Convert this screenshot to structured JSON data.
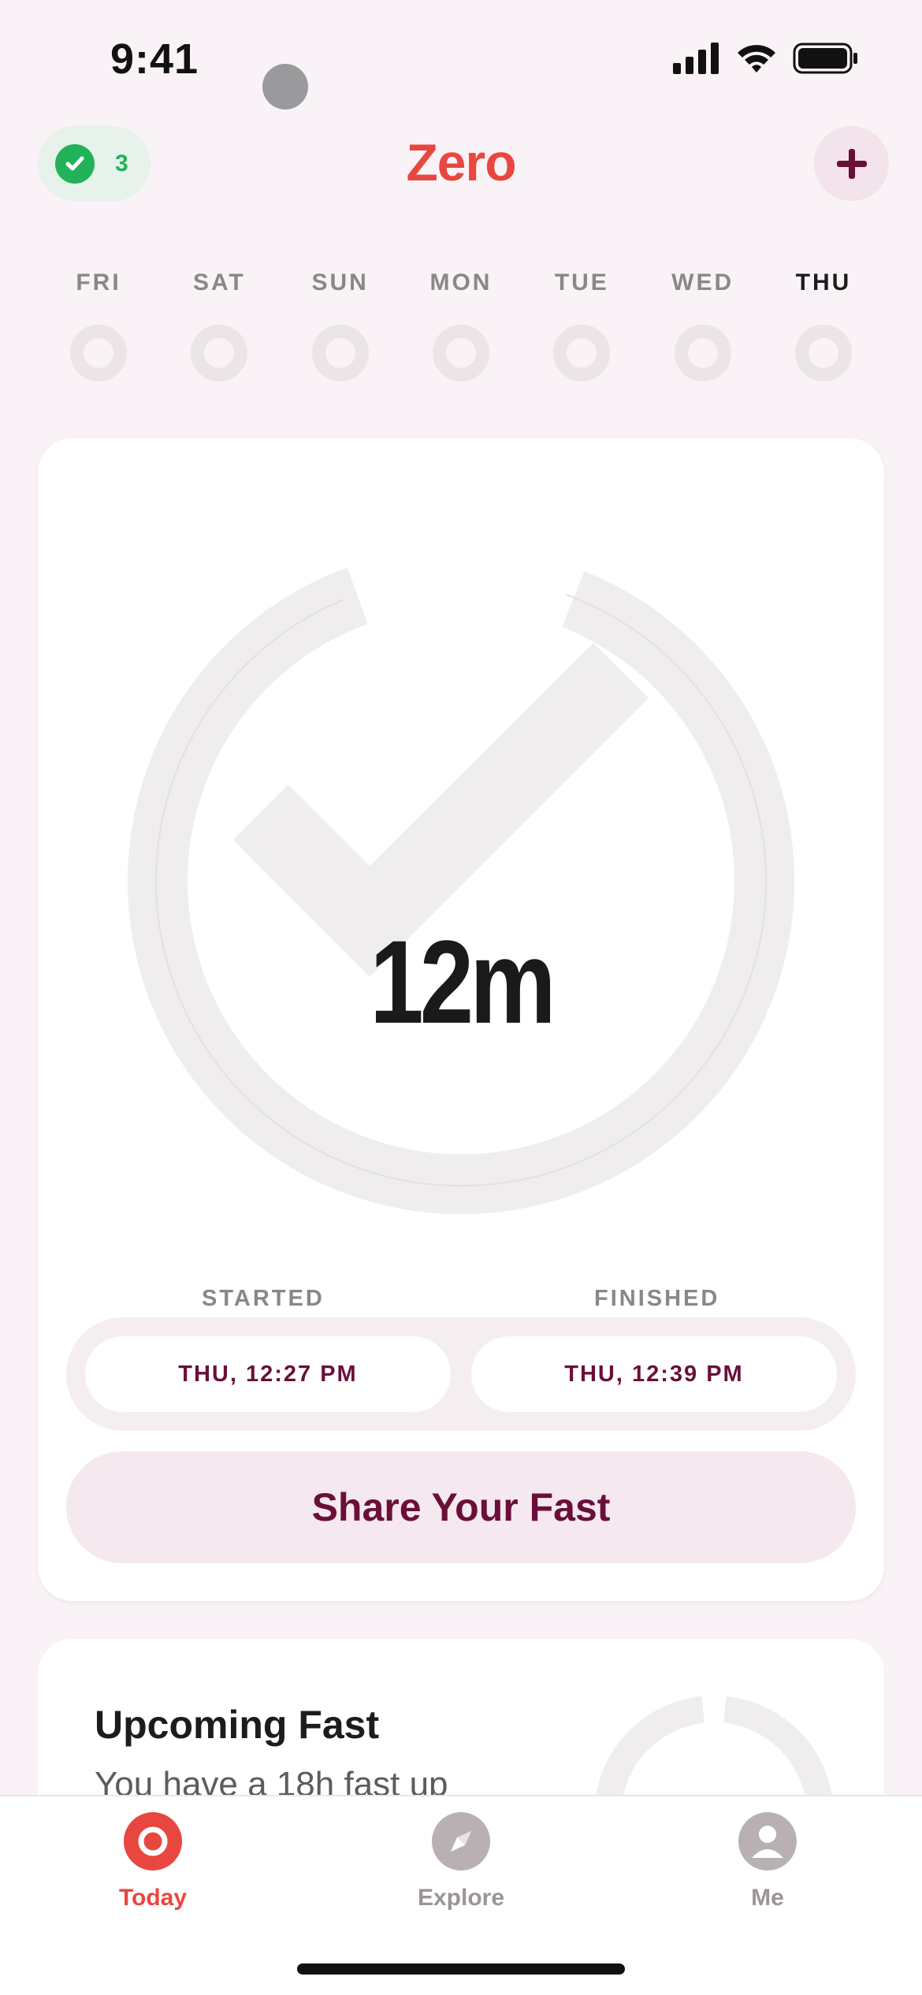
{
  "status_bar": {
    "time": "9:41"
  },
  "header": {
    "streak_count": "3",
    "title": "Zero",
    "add_icon": "plus-icon"
  },
  "week": {
    "days": [
      "FRI",
      "SAT",
      "SUN",
      "MON",
      "TUE",
      "WED",
      "THU"
    ],
    "today": "THU"
  },
  "fast": {
    "elapsed": "12m",
    "started_label": "STARTED",
    "finished_label": "FINISHED",
    "started_value": "THU, 12:27 PM",
    "finished_value": "THU, 12:39 PM",
    "share_label": "Share Your Fast"
  },
  "upcoming": {
    "title": "Upcoming Fast",
    "body": "You have a 18h fast up"
  },
  "tabs": [
    {
      "label": "Today",
      "icon": "today-icon",
      "active": true
    },
    {
      "label": "Explore",
      "icon": "compass-icon",
      "active": false
    },
    {
      "label": "Me",
      "icon": "person-icon",
      "active": false
    }
  ],
  "colors": {
    "accent": "#e8473f",
    "brand_dark": "#6a0f39",
    "streak_green": "#21b25a",
    "background": "#f9f2f6"
  }
}
